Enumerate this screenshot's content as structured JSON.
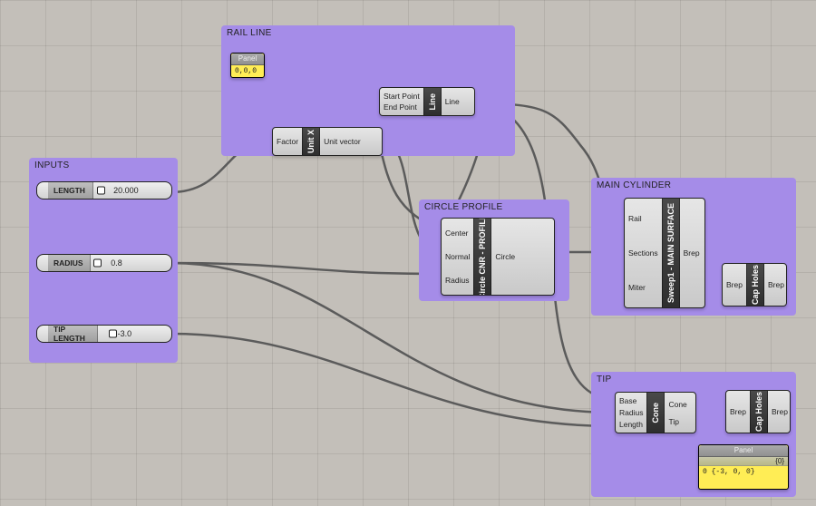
{
  "groups": {
    "inputs": {
      "title": "INPUTS"
    },
    "rail": {
      "title": "RAIL LINE"
    },
    "circle": {
      "title": "CIRCLE PROFILE"
    },
    "cylinder": {
      "title": "MAIN CYLINDER"
    },
    "tip": {
      "title": "TIP"
    }
  },
  "sliders": {
    "length": {
      "label": "LENGTH",
      "value": "20.000"
    },
    "radius": {
      "label": "RADIUS",
      "value": "0.8"
    },
    "tiplength": {
      "label": "TIP LENGTH",
      "value": "-3.0"
    }
  },
  "panels": {
    "origin": {
      "title": "Panel",
      "body": "0,0,0"
    },
    "tipout": {
      "title": "Panel",
      "header": "{0}",
      "body": "0 {-3, 0, 0}"
    }
  },
  "nodes": {
    "unitx": {
      "name": "Unit X",
      "inputs": [
        "Factor"
      ],
      "outputs": [
        "Unit vector"
      ]
    },
    "line": {
      "name": "Line",
      "inputs": [
        "Start Point",
        "End Point"
      ],
      "outputs": [
        "Line"
      ]
    },
    "circle": {
      "name": "Circle CNR - PROFILE",
      "inputs": [
        "Center",
        "Normal",
        "Radius"
      ],
      "outputs": [
        "Circle"
      ]
    },
    "sweep": {
      "name": "Sweep1 - MAIN SURFACE",
      "inputs": [
        "Rail",
        "Sections",
        "Miter"
      ],
      "outputs": [
        "Brep"
      ]
    },
    "cap1": {
      "name": "Cap Holes",
      "inputs": [
        "Brep"
      ],
      "outputs": [
        "Brep"
      ]
    },
    "cone": {
      "name": "Cone",
      "inputs": [
        "Base",
        "Radius",
        "Length"
      ],
      "outputs": [
        "Cone",
        "Tip"
      ]
    },
    "cap2": {
      "name": "Cap Holes",
      "inputs": [
        "Brep"
      ],
      "outputs": [
        "Brep"
      ]
    }
  }
}
